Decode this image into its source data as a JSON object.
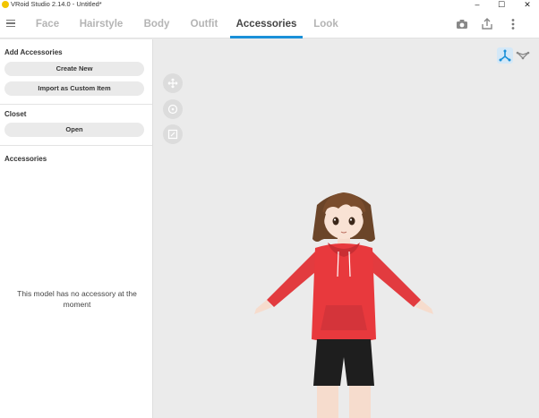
{
  "window": {
    "title": "VRoid Studio 2.14.0 - Untitled*",
    "controls": {
      "minimize": "–",
      "maximize": "☐",
      "close": "✕"
    },
    "icon": "vroid-logo-icon"
  },
  "tabs": [
    {
      "label": "Face"
    },
    {
      "label": "Hairstyle"
    },
    {
      "label": "Body"
    },
    {
      "label": "Outfit"
    },
    {
      "label": "Accessories",
      "active": true
    },
    {
      "label": "Look"
    }
  ],
  "toolbar_icons": [
    "menu-icon",
    "camera-icon",
    "export-icon",
    "more-vertical-icon"
  ],
  "left_panel": {
    "add_accessories": {
      "title": "Add Accessories",
      "create_new": "Create New",
      "import_custom": "Import as Custom Item"
    },
    "closet": {
      "title": "Closet",
      "open": "Open"
    },
    "accessories": {
      "title": "Accessories",
      "empty_message": "This model has no accessory at the moment"
    }
  },
  "viewport": {
    "controls": [
      "move-view-icon",
      "rotate-view-icon",
      "zoom-view-icon"
    ],
    "view_modes": [
      "pose-mode-icon",
      "mesh-mode-icon"
    ],
    "accent_color": "#1a90d8"
  }
}
